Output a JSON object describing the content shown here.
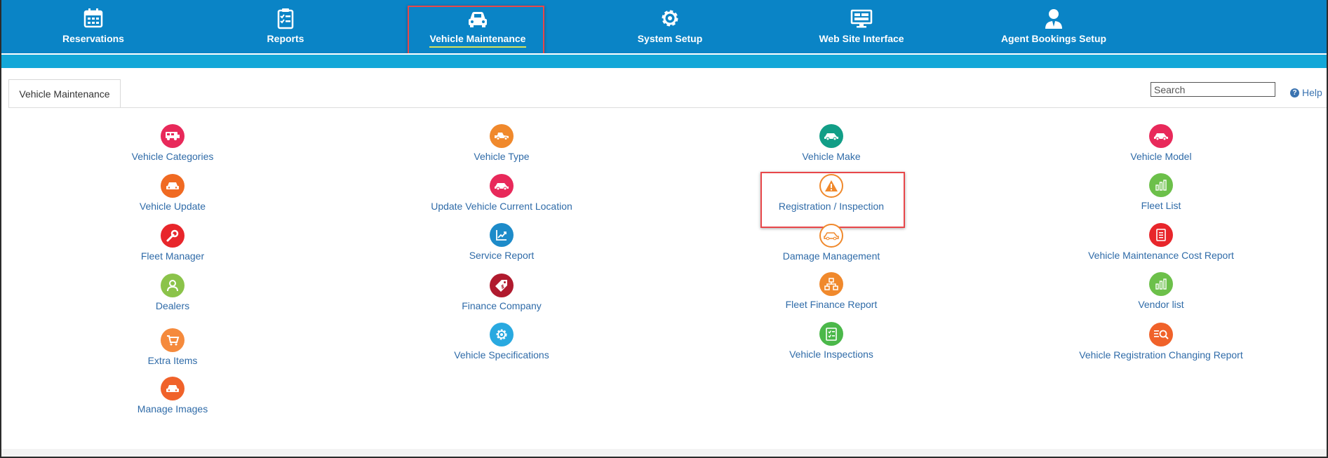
{
  "nav": {
    "items": [
      {
        "label": "Reservations",
        "icon": "calendar-icon"
      },
      {
        "label": "Reports",
        "icon": "clipboard-checklist-icon"
      },
      {
        "label": "Vehicle Maintenance",
        "icon": "car-icon"
      },
      {
        "label": "System Setup",
        "icon": "gear-icon"
      },
      {
        "label": "Web Site Interface",
        "icon": "monitor-icon"
      },
      {
        "label": "Agent Bookings Setup",
        "icon": "agent-icon"
      }
    ],
    "active": "Vehicle Maintenance"
  },
  "tab": {
    "label": "Vehicle Maintenance"
  },
  "search": {
    "placeholder": "Search"
  },
  "help": {
    "label": "Help"
  },
  "grid": {
    "col1": [
      {
        "label": "Vehicle Categories",
        "color": "#e8295a",
        "icon": "rv-icon"
      },
      {
        "label": "Vehicle Update",
        "color": "#f06a22",
        "icon": "car-front-icon"
      },
      {
        "label": "Fleet Manager",
        "color": "#e8262b",
        "icon": "wrench-icon"
      },
      {
        "label": "Dealers",
        "color": "#8bc34a",
        "icon": "person-icon"
      },
      {
        "label": "Extra Items",
        "color": "#f58a3c",
        "icon": "cart-icon"
      },
      {
        "label": "Manage Images",
        "color": "#f0622a",
        "icon": "car-front-icon"
      }
    ],
    "col2": [
      {
        "label": "Vehicle Type",
        "color": "#f0892c",
        "icon": "pickup-icon"
      },
      {
        "label": "Update Vehicle Current Location",
        "color": "#e8295a",
        "icon": "car-side-icon"
      },
      {
        "label": "Service Report",
        "color": "#1d8bc9",
        "icon": "trend-chart-icon"
      },
      {
        "label": "Finance Company",
        "color": "#b01a2e",
        "icon": "price-tag-icon"
      },
      {
        "label": "Vehicle Specifications",
        "color": "#29a9e0",
        "icon": "gear-icon"
      }
    ],
    "col3": [
      {
        "label": "Vehicle Make",
        "color": "#129e87",
        "icon": "car-side-icon"
      },
      {
        "label": "Registration / Inspection",
        "color": "#ffffff",
        "icon": "warning-icon"
      },
      {
        "label": "Damage Management",
        "color": "#ffffff",
        "icon": "damaged-car-icon"
      },
      {
        "label": "Fleet Finance Report",
        "color": "#f0892c",
        "icon": "org-chart-icon"
      },
      {
        "label": "Vehicle Inspections",
        "color": "#4bb84a",
        "icon": "checklist-icon"
      }
    ],
    "col4": [
      {
        "label": "Vehicle Model",
        "color": "#e8295a",
        "icon": "car-side-icon"
      },
      {
        "label": "Fleet List",
        "color": "#6cc04a",
        "icon": "bar-chart-icon"
      },
      {
        "label": "Vehicle Maintenance Cost Report",
        "color": "#e8262b",
        "icon": "document-icon"
      },
      {
        "label": "Vendor list",
        "color": "#6cc04a",
        "icon": "bar-chart-icon"
      },
      {
        "label": "Vehicle Registration Changing Report",
        "color": "#f0622a",
        "icon": "search-list-icon"
      }
    ]
  },
  "colors": {
    "nav_bg": "#0a84c6",
    "subbar": "#12a7d8",
    "link": "#2f6ba8",
    "highlight": "#e8474a"
  }
}
